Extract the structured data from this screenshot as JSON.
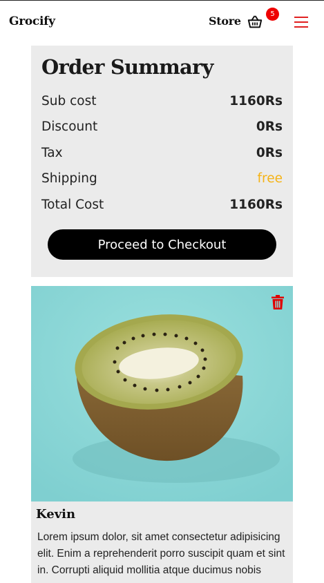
{
  "navbar": {
    "brand": "Grocify",
    "store_label": "Store",
    "cart_count": "5",
    "icons": {
      "cart": "basket-icon",
      "menu": "hamburger-menu-icon"
    }
  },
  "summary": {
    "title": "Order Summary",
    "rows": [
      {
        "label": "Sub cost",
        "value": "1160Rs"
      },
      {
        "label": "Discount",
        "value": "0Rs"
      },
      {
        "label": "Tax",
        "value": "0Rs"
      },
      {
        "label": "Shipping",
        "value": "free"
      },
      {
        "label": "Total Cost",
        "value": "1160Rs"
      }
    ],
    "checkout_label": "Proceed to Checkout"
  },
  "product": {
    "name": "Kevin",
    "image_icon": "kiwi-image",
    "delete_icon": "trash-icon",
    "description": "Lorem ipsum dolor, sit amet consectetur adipisicing elit. Enim a reprehenderit porro suscipit quam et sint in. Corrupti aliquid mollitia atque ducimus nobis"
  },
  "colors": {
    "accent_free": "#f5b316",
    "badge": "#ee0000",
    "menu_icon": "#e02020",
    "trash_icon": "#e00000",
    "panel_bg": "#ebebeb",
    "image_bg": "#8fd8d8"
  }
}
